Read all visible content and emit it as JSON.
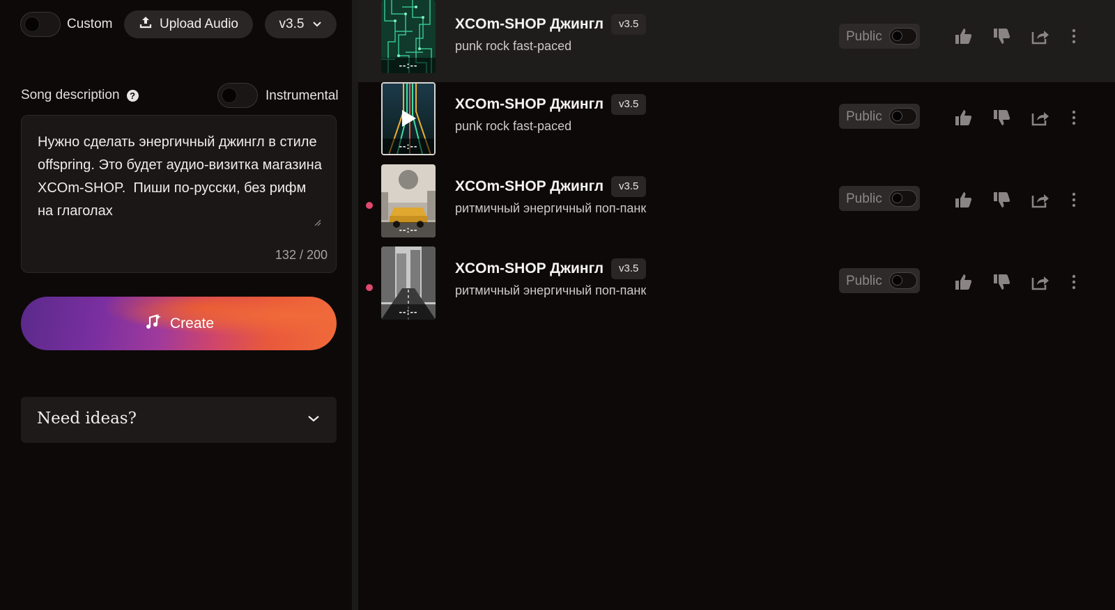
{
  "left": {
    "custom_label": "Custom",
    "upload_label": "Upload Audio",
    "version_label": "v3.5",
    "song_description_label": "Song description",
    "instrumental_label": "Instrumental",
    "description_text": "Нужно сделать энергичный джингл в стиле offspring. Это будет аудио-визитка магазина XCOm-SHOP.  Пиши по-русски, без рифм на глаголах",
    "description_counter": "132 / 200",
    "create_label": "Create",
    "need_ideas_label": "Need ideas?"
  },
  "songs": [
    {
      "title": "XCOm-SHOP Джингл",
      "version": "v3.5",
      "style": "punk rock fast-paced",
      "duration": "--:--",
      "public_label": "Public",
      "thumb": "circuit-board"
    },
    {
      "title": "XCOm-SHOP Джингл",
      "version": "v3.5",
      "style": "punk rock fast-paced",
      "duration": "--:--",
      "public_label": "Public",
      "thumb": "neon-circuit"
    },
    {
      "title": "XCOm-SHOP Джингл",
      "version": "v3.5",
      "style": "ритмичный энергичный поп-панк",
      "duration": "--:--",
      "public_label": "Public",
      "thumb": "yellow-taxi"
    },
    {
      "title": "XCOm-SHOP Джингл",
      "version": "v3.5",
      "style": "ритмичный энергичный поп-панк",
      "duration": "--:--",
      "public_label": "Public",
      "thumb": "city-street"
    }
  ],
  "colors": {
    "background": "#0d0909",
    "unread_dot": "#e0486c",
    "create_gradient_start": "#5a2a8a",
    "create_gradient_end": "#f06a3a"
  }
}
